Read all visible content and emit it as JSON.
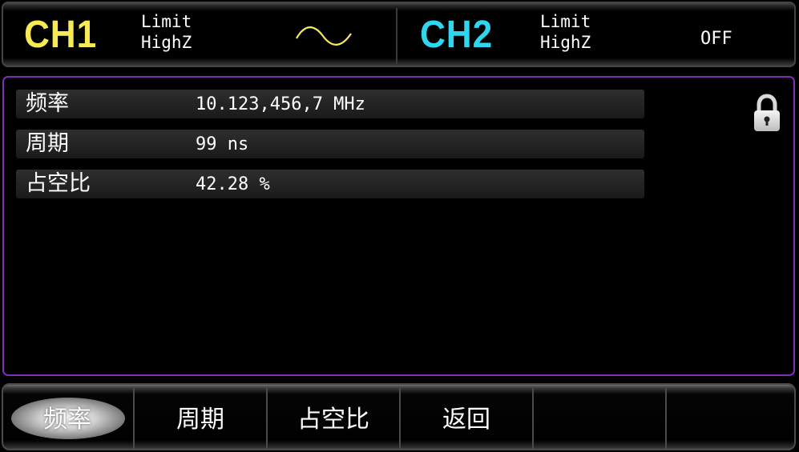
{
  "header": {
    "ch1": {
      "name": "CH1",
      "name_color": "#f6ea55",
      "load_line1": "Limit",
      "load_line2": "HighZ",
      "waveform_icon": "sine-wave-icon",
      "waveform_color": "#f6ea55"
    },
    "ch2": {
      "name": "CH2",
      "name_color": "#2fd6f0",
      "load_line1": "Limit",
      "load_line2": "HighZ",
      "status": "OFF"
    }
  },
  "main": {
    "border_color": "#7d2fb6",
    "lock_icon": "lock-icon",
    "params": [
      {
        "label": "频率",
        "value": "10.123,456,7 MHz"
      },
      {
        "label": "周期",
        "value": "99 ns"
      },
      {
        "label": "占空比",
        "value": "42.28 %"
      }
    ]
  },
  "softkeys": [
    {
      "label": "频率",
      "selected": true
    },
    {
      "label": "周期",
      "selected": false
    },
    {
      "label": "占空比",
      "selected": false
    },
    {
      "label": "返回",
      "selected": false
    },
    {
      "label": "",
      "selected": false
    },
    {
      "label": "",
      "selected": false
    }
  ]
}
